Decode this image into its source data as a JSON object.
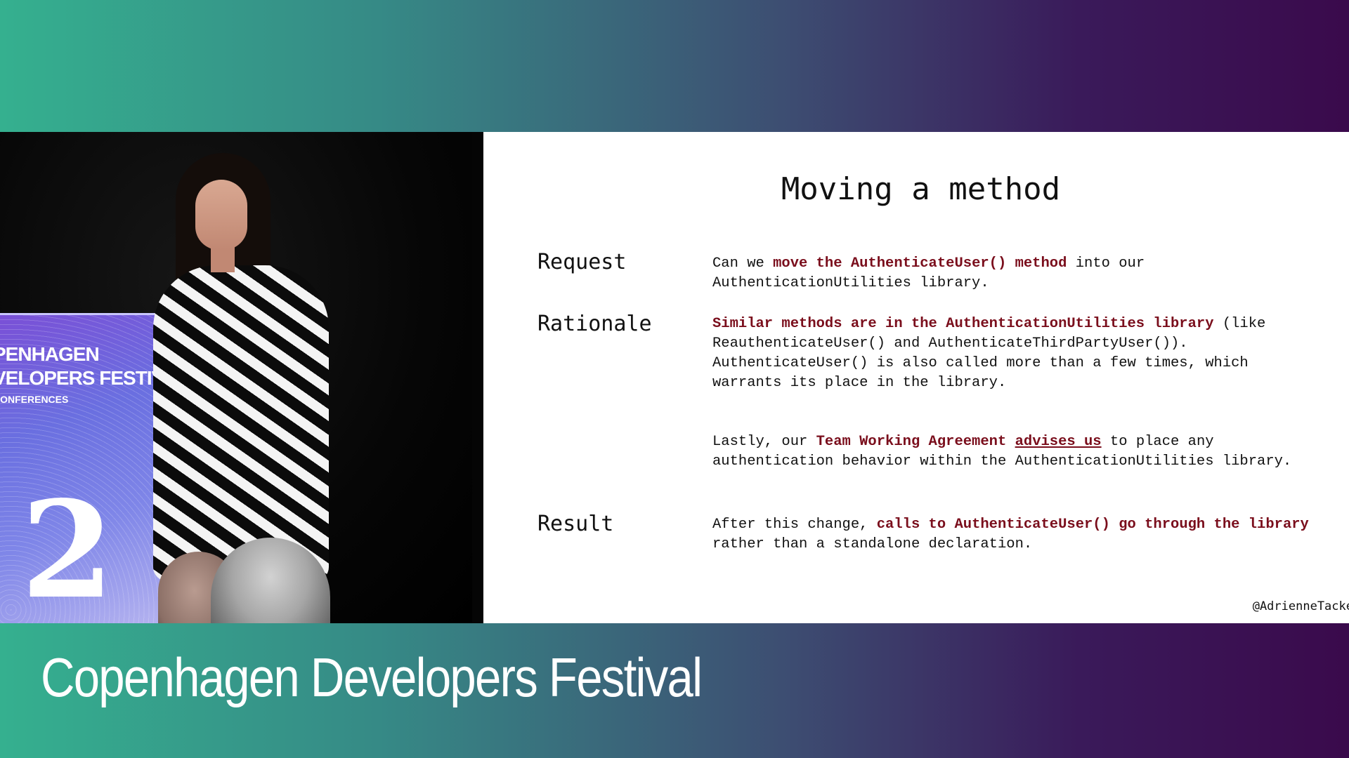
{
  "event": {
    "title": "Copenhagen Developers Festival"
  },
  "podium": {
    "line1": "PENHAGEN",
    "line2": "VELOPERS FESTIVAL",
    "line3": "CONFERENCES",
    "number": "2"
  },
  "slide": {
    "title": "Moving a method",
    "request": {
      "label": "Request",
      "p1": "Can we ",
      "p2": "move the AuthenticateUser() method",
      "p3": " into our AuthenticationUtilities library."
    },
    "rationale": {
      "label": "Rationale",
      "a1": "Similar methods are in the AuthenticationUtilities library",
      "a2": " (like ReauthenticateUser() and AuthenticateThirdPartyUser()). AuthenticateUser() is also called more than a few times, which warrants its place in the library.",
      "b1": "Lastly, our ",
      "b2": "Team Working Agreement",
      "b3": " ",
      "b4": "advises us",
      "b5": " to place any authentication behavior within the AuthenticationUtilities library."
    },
    "result": {
      "label": "Result",
      "c1": "After this change, ",
      "c2": "calls to AuthenticateUser() go through the library",
      "c3": " rather than a standalone declaration."
    },
    "handle": "@AdrienneTacke"
  }
}
